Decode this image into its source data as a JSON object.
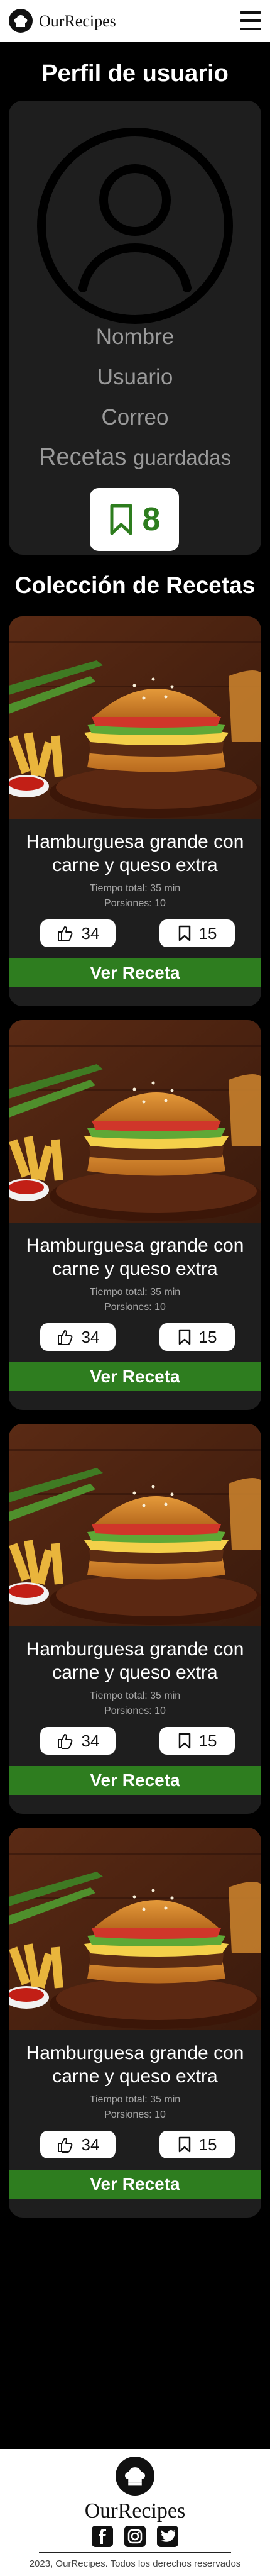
{
  "header": {
    "brand": "OurRecipes",
    "logo_icon": "chef-hat-icon",
    "menu_icon": "hamburger-menu-icon"
  },
  "profile": {
    "title": "Perfil de usuario",
    "avatar_icon": "user-avatar-icon",
    "nombre": "Nombre",
    "usuario": "Usuario",
    "correo": "Correo",
    "recetas": "Recetas",
    "guardadas": "guardadas",
    "saved_count": "8",
    "saved_icon": "bookmark-icon"
  },
  "collection": {
    "title": "Colección de Recetas",
    "recipes": [
      {
        "name": "Hamburguesa grande con carne y queso extra",
        "tiempo": "Tiempo total: 35 min",
        "porciones": "Porsiones: 10",
        "likes": "34",
        "saves": "15",
        "button": "Ver Receta"
      },
      {
        "name": "Hamburguesa grande con carne y queso extra",
        "tiempo": "Tiempo total: 35 min",
        "porciones": "Porsiones: 10",
        "likes": "34",
        "saves": "15",
        "button": "Ver Receta"
      },
      {
        "name": "Hamburguesa grande con carne y queso extra",
        "tiempo": "Tiempo total: 35 min",
        "porciones": "Porsiones: 10",
        "likes": "34",
        "saves": "15",
        "button": "Ver Receta"
      },
      {
        "name": "Hamburguesa grande con carne y queso extra",
        "tiempo": "Tiempo total: 35 min",
        "porciones": "Porsiones: 10",
        "likes": "34",
        "saves": "15",
        "button": "Ver Receta"
      }
    ]
  },
  "footer": {
    "brand": "OurRecipes",
    "social": [
      "facebook-icon",
      "instagram-icon",
      "twitter-icon"
    ],
    "copyright": "2023, OurRecipes. Todos los derechos reservados"
  },
  "colors": {
    "accent_green": "#2e7d1f",
    "card_bg": "#1e1e1e",
    "page_bg": "#000000"
  }
}
